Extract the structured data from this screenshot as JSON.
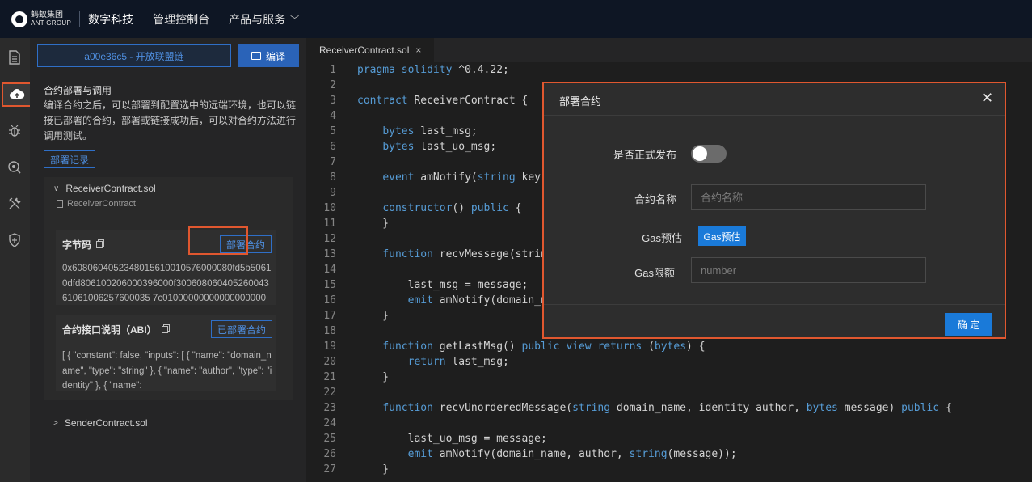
{
  "nav": {
    "logo_cn": "蚂蚁集团",
    "logo_en": "ANT GROUP",
    "brand": "数字科技",
    "console": "管理控制台",
    "products": "产品与服务"
  },
  "panel": {
    "chain_label": "a00e36c5 - 开放联盟链",
    "compile_label": "编译",
    "deploy_title": "合约部署与调用",
    "deploy_desc": "编译合约之后，可以部署到配置选中的远端环境，也可以链接已部署的合约，部署或链接成功后，可以对合约方法进行调用测试。",
    "record_label": "部署记录",
    "contract_file": "ReceiverContract.sol",
    "contract_name": "ReceiverContract",
    "bytecode_title": "字节码",
    "bytecode_btn": "部署合约",
    "bytecode_value": "0x6080604052348015610010576000080fd5b50610dfd806100206000396000f30060806040526004361061006257600035 7c01000000000000000000",
    "abi_title": "合约接口说明（ABI）",
    "abi_btn": "已部署合约",
    "abi_value": "[ { \"constant\": false, \"inputs\": [ { \"name\": \"domain_name\", \"type\": \"string\" }, { \"name\": \"author\", \"type\": \"identity\" }, { \"name\":",
    "sender_file": "SenderContract.sol"
  },
  "editor": {
    "tab_label": "ReceiverContract.sol",
    "lines": [
      "pragma solidity ^0.4.22;",
      "",
      "contract ReceiverContract {",
      "",
      "    bytes last_msg;",
      "    bytes last_uo_msg;",
      "",
      "    event amNotify(string key,",
      "",
      "    constructor() public {",
      "    }",
      "",
      "    function recvMessage(strin",
      "",
      "        last_msg = message;",
      "        emit amNotify(domain_n",
      "    }",
      "",
      "    function getLastMsg() public view returns (bytes) {",
      "        return last_msg;",
      "    }",
      "",
      "    function recvUnorderedMessage(string domain_name, identity author, bytes message) public {",
      "",
      "        last_uo_msg = message;",
      "        emit amNotify(domain_name, author, string(message));",
      "    }"
    ]
  },
  "modal": {
    "title": "部署合约",
    "publish_label": "是否正式发布",
    "publish_on": false,
    "name_label": "合约名称",
    "name_placeholder": "合约名称",
    "gas_est_label": "Gas预估",
    "gas_est_btn": "Gas预估",
    "gas_limit_label": "Gas限额",
    "gas_limit_placeholder": "number",
    "ok_label": "确 定"
  },
  "colors": {
    "accent": "#1a7ad9",
    "highlight": "#e0572f",
    "keyword": "#569cd6"
  }
}
